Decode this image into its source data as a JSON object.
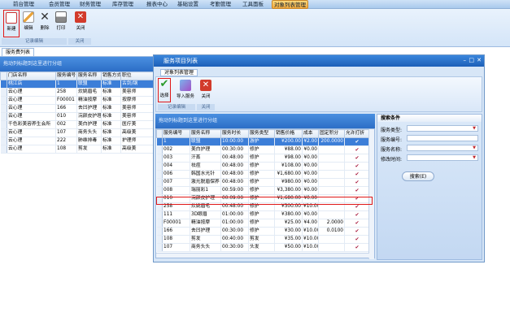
{
  "top_menu": [
    {
      "label": "前台管理",
      "x": "menu"
    },
    {
      "label": "会员管理"
    },
    {
      "label": "财务管理"
    },
    {
      "label": "库存管理"
    },
    {
      "label": "报表中心"
    },
    {
      "label": "基础设置"
    },
    {
      "label": "考勤管理"
    },
    {
      "label": "工具面板"
    },
    {
      "label": "对象列表管理"
    }
  ],
  "ribbon": {
    "new": "新建",
    "edit": "编辑",
    "delete": "删除",
    "print": "打印",
    "close": "关闭",
    "group_record": "记录编辑",
    "group_close": "关闭"
  },
  "left": {
    "tab": "服务费列表",
    "banner": "拖动列标题到这里进行分组",
    "columns": [
      "门店名称",
      "服务编号",
      "服务名称",
      "销售方式",
      "职位"
    ],
    "rows": [
      [
        "桃江店",
        "1",
        "联盟",
        "标准",
        "古剑/钢"
      ],
      [
        "云心理",
        "258",
        "炊姚眉毛",
        "标准",
        "美容师"
      ],
      [
        "云心理",
        "F00001",
        "精油按摩",
        "标准",
        "按摩师"
      ],
      [
        "云心理",
        "166",
        "去凹护理",
        "标准",
        "美容师"
      ],
      [
        "云心理",
        "010",
        "浣颜皮护理",
        "标准",
        "美容师"
      ],
      [
        "千色彩美容养生会所",
        "002",
        "美白护理",
        "标准",
        "医疗美"
      ],
      [
        "云心理",
        "107",
        "商务头头",
        "标准",
        "高级美"
      ],
      [
        "云心理",
        "222",
        "肺维排毒",
        "标准",
        "护理师"
      ],
      [
        "云心理",
        "108",
        "剪发",
        "标准",
        "高级美"
      ]
    ]
  },
  "dialog": {
    "title": "服务项目列表",
    "tab": "对象列表管理",
    "select": "选择",
    "import": "导入服务",
    "close": "关闭",
    "group_record": "记录编辑",
    "group_close": "关闭",
    "banner": "拖动列标题到这里进行分组",
    "columns": [
      "服务编号",
      "服务名称",
      "服务时长",
      "服务类型",
      "销售价格",
      "成本",
      "固定积分",
      "允许打折"
    ],
    "rows": [
      [
        "1",
        "联盟",
        "10:00:00",
        "游护",
        "¥200.00",
        "¥2.00",
        "200.0000",
        "✔"
      ],
      [
        "002",
        "美白护理",
        "00:30:00",
        "修护",
        "¥88.00",
        "¥0.00",
        "",
        "✔"
      ],
      [
        "003",
        "汗蒸",
        "00:48:00",
        "修护",
        "¥98.00",
        "¥0.00",
        "",
        "✔"
      ],
      [
        "004",
        "祛痘",
        "00:48:00",
        "修护",
        "¥108.00",
        "¥0.00",
        "",
        "✔"
      ],
      [
        "006",
        "韩国水光针",
        "00:48:00",
        "修护",
        "¥1,680.00",
        "¥0.00",
        "",
        "✔"
      ],
      [
        "007",
        "激光脱眉保养",
        "00:48:00",
        "修护",
        "¥980.00",
        "¥0.00",
        "",
        "✔"
      ],
      [
        "008",
        "瑞丽彩1",
        "00:59:00",
        "修护",
        "¥3,380.00",
        "¥0.00",
        "",
        "✔"
      ],
      [
        "010",
        "浣颜皮护理",
        "00:09:00",
        "修护",
        "¥1,680.00",
        "¥0.00",
        "",
        "✔"
      ],
      [
        "258",
        "炊姚眉毛",
        "00:48:00",
        "修护",
        "¥300.00",
        "¥10.00",
        "",
        "✔"
      ],
      [
        "111",
        "3D眼眉",
        "01:00:00",
        "修护",
        "¥380.00",
        "¥0.00",
        "",
        "✔"
      ],
      [
        "F00001",
        "精油按摩",
        "01:00:00",
        "修护",
        "¥25.00",
        "¥4.00",
        "2.0000",
        "✔"
      ],
      [
        "166",
        "去凹护理",
        "00:30:00",
        "修护",
        "¥30.00",
        "¥10.00",
        "0.0100",
        "✔"
      ],
      [
        "108",
        "剪发",
        "00:40:00",
        "剪发",
        "¥35.00",
        "¥10.00",
        "",
        "✔"
      ],
      [
        "107",
        "商务头头",
        "00:30:00",
        "头发",
        "¥50.00",
        "¥10.00",
        "",
        "✔"
      ]
    ]
  },
  "search": {
    "title": "搜索条件",
    "type_label": "服务类型:",
    "id_label": "服务编号:",
    "name_label": "服务名称:",
    "time_label": "修改时间:",
    "button": "搜索(E)"
  }
}
